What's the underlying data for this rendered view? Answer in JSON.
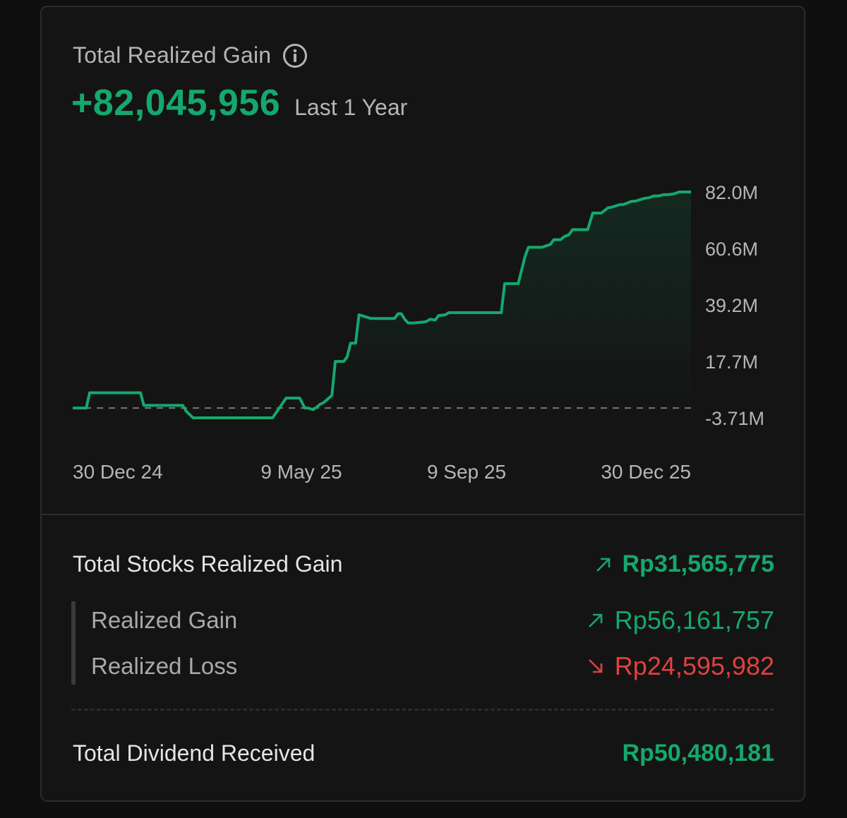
{
  "header": {
    "title": "Total Realized Gain",
    "info_icon": "info-icon",
    "amount": "+82,045,956",
    "period": "Last 1 Year"
  },
  "colors": {
    "accent_green": "#15a86e",
    "loss_red": "#e0413f",
    "background": "#141414"
  },
  "chart_data": {
    "type": "line",
    "title": "",
    "xlabel": "",
    "ylabel": "",
    "x_tick_labels": [
      "30 Dec 24",
      "9 May 25",
      "9 Sep 25",
      "30 Dec 25"
    ],
    "y_tick_labels": [
      "82.0M",
      "60.6M",
      "39.2M",
      "17.7M",
      "-3.71M"
    ],
    "y_ticks": [
      82.0,
      60.6,
      39.2,
      17.7,
      -3.71
    ],
    "ylim": [
      -3.71,
      82.0
    ],
    "y_unit": "M",
    "zero_line": "dashed",
    "grid": false,
    "legend": "none",
    "line_style": "step",
    "series": [
      {
        "x": [
          "2024-12-30",
          "2025-01-07",
          "2025-01-09",
          "2025-02-08",
          "2025-02-10",
          "2025-03-05",
          "2025-03-07",
          "2025-03-11",
          "2025-04-27",
          "2025-05-01",
          "2025-05-05",
          "2025-05-13",
          "2025-05-16",
          "2025-05-18",
          "2025-05-21",
          "2025-05-23",
          "2025-05-25",
          "2025-05-27",
          "2025-06-01",
          "2025-06-03",
          "2025-06-08",
          "2025-06-10",
          "2025-06-12",
          "2025-06-15",
          "2025-06-17",
          "2025-06-24",
          "2025-06-26",
          "2025-07-08",
          "2025-07-10",
          "2025-07-12",
          "2025-07-14",
          "2025-07-16",
          "2025-07-19",
          "2025-07-25",
          "2025-07-27",
          "2025-07-29",
          "2025-08-01",
          "2025-08-03",
          "2025-08-07",
          "2025-08-09",
          "2025-09-09",
          "2025-09-11",
          "2025-09-17",
          "2025-09-19",
          "2025-09-23",
          "2025-09-25",
          "2025-10-01",
          "2025-10-03",
          "2025-10-08",
          "2025-10-10",
          "2025-10-14",
          "2025-10-16",
          "2025-10-19",
          "2025-10-21",
          "2025-10-30",
          "2025-11-02",
          "2025-11-05",
          "2025-11-07",
          "2025-11-11",
          "2025-11-13",
          "2025-11-18",
          "2025-11-20",
          "2025-11-25",
          "2025-11-27",
          "2025-12-02",
          "2025-12-05",
          "2025-12-08",
          "2025-12-11",
          "2025-12-14",
          "2025-12-17",
          "2025-12-20",
          "2025-12-23",
          "2025-12-30"
        ],
        "y": [
          0.0,
          0.0,
          5.8,
          5.8,
          1.0,
          1.0,
          -1.2,
          -3.7,
          -3.7,
          0.0,
          3.8,
          3.8,
          0.0,
          0.0,
          -0.6,
          0.3,
          1.4,
          2.0,
          4.8,
          17.7,
          17.7,
          19.4,
          24.6,
          24.6,
          35.4,
          34.0,
          34.0,
          34.0,
          35.8,
          35.8,
          33.7,
          32.3,
          32.3,
          32.6,
          32.9,
          33.7,
          33.4,
          35.1,
          35.4,
          36.2,
          36.2,
          47.2,
          47.2,
          47.2,
          57.5,
          61.0,
          61.0,
          61.0,
          62.1,
          63.9,
          63.9,
          65.0,
          65.8,
          67.7,
          67.7,
          74.0,
          74.0,
          74.0,
          76.0,
          76.2,
          77.2,
          77.2,
          78.5,
          78.5,
          79.5,
          79.8,
          80.5,
          80.5,
          81.0,
          81.0,
          81.3,
          82.0,
          82.0
        ]
      }
    ]
  },
  "summary": {
    "stocks_label": "Total Stocks Realized Gain",
    "stocks_value": "Rp31,565,775",
    "realized_gain_label": "Realized Gain",
    "realized_gain_value": "Rp56,161,757",
    "realized_loss_label": "Realized Loss",
    "realized_loss_value": "Rp24,595,982",
    "dividend_label": "Total Dividend Received",
    "dividend_value": "Rp50,480,181",
    "up_arrow_icon": "arrow-up-right-icon",
    "down_arrow_icon": "arrow-down-right-icon"
  }
}
